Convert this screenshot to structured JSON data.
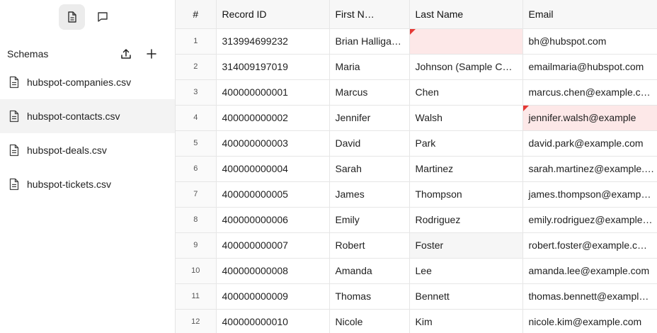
{
  "sidebar": {
    "title": "Schemas",
    "files": [
      {
        "name": "hubspot-companies.csv",
        "selected": false
      },
      {
        "name": "hubspot-contacts.csv",
        "selected": true
      },
      {
        "name": "hubspot-deals.csv",
        "selected": false
      },
      {
        "name": "hubspot-tickets.csv",
        "selected": false
      }
    ]
  },
  "table": {
    "columns": [
      "#",
      "Record ID",
      "First N…",
      "Last Name",
      "Email"
    ],
    "rows": [
      [
        "1",
        "313994699232",
        "Brian Halligan…",
        "",
        "bh@hubspot.com"
      ],
      [
        "2",
        "314009197019",
        "Maria",
        "Johnson (Sample Co…",
        "emailmaria@hubspot.com"
      ],
      [
        "3",
        "400000000001",
        "Marcus",
        "Chen",
        "marcus.chen@example.c…"
      ],
      [
        "4",
        "400000000002",
        "Jennifer",
        "Walsh",
        "jennifer.walsh@example"
      ],
      [
        "5",
        "400000000003",
        "David",
        "Park",
        "david.park@example.com"
      ],
      [
        "6",
        "400000000004",
        "Sarah",
        "Martinez",
        "sarah.martinez@example.…"
      ],
      [
        "7",
        "400000000005",
        "James",
        "Thompson",
        "james.thompson@examp…"
      ],
      [
        "8",
        "400000000006",
        "Emily",
        "Rodriguez",
        "emily.rodriguez@example…"
      ],
      [
        "9",
        "400000000007",
        "Robert",
        "Foster",
        "robert.foster@example.c…"
      ],
      [
        "10",
        "400000000008",
        "Amanda",
        "Lee",
        "amanda.lee@example.com"
      ],
      [
        "11",
        "400000000009",
        "Thomas",
        "Bennett",
        "thomas.bennett@exampl…"
      ],
      [
        "12",
        "400000000010",
        "Nicole",
        "Kim",
        "nicole.kim@example.com"
      ]
    ],
    "error_cells": [
      [
        0,
        3
      ],
      [
        3,
        4
      ]
    ],
    "hover_cell": [
      8,
      3
    ]
  },
  "colors": {
    "error_bg": "#fde8e8",
    "error_flag": "#e53935"
  }
}
